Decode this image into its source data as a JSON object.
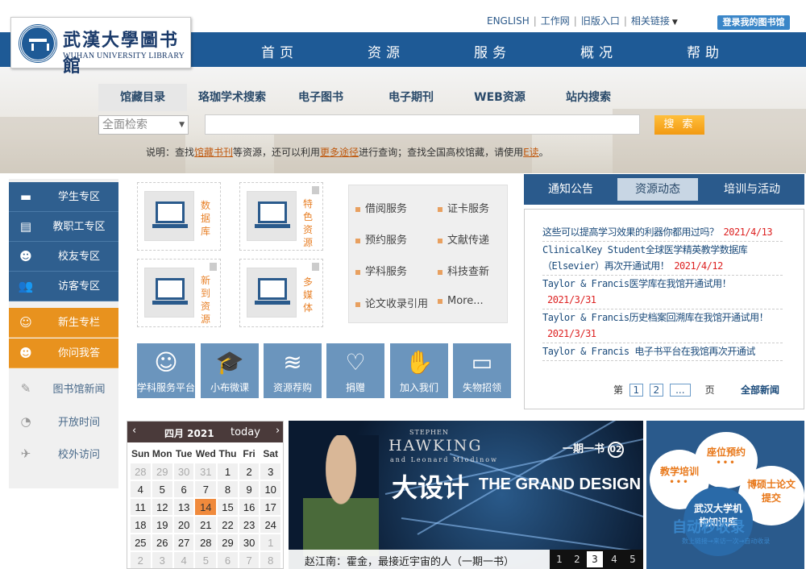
{
  "header": {
    "logo_cn": "武漢大學圖书館",
    "logo_en": "WUHAN UNIVERSITY LIBRARY",
    "top_links": [
      "ENGLISH",
      "工作网",
      "旧版入口",
      "相关链接"
    ],
    "my_library": "登录我的图书馆",
    "nav": [
      "首页",
      "资源",
      "服务",
      "概况",
      "帮助"
    ]
  },
  "search": {
    "tabs": [
      "馆藏目录",
      "珞珈学术搜索",
      "电子图书",
      "电子期刊",
      "WEB资源",
      "站内搜索"
    ],
    "select_value": "全面检索",
    "input_value": "",
    "button": "搜 索",
    "tip_prefix": "说明：查找",
    "tip_link1": "馆藏书刊",
    "tip_mid1": "等资源，还可以利用",
    "tip_link2": "更多途径",
    "tip_mid2": "进行查询；查找全国高校馆藏，请使用",
    "tip_link3": "E读",
    "tip_end": "。"
  },
  "sidebar": {
    "items": [
      {
        "label": "学生专区",
        "icon": "student-icon"
      },
      {
        "label": "教职工专区",
        "icon": "faculty-icon"
      },
      {
        "label": "校友专区",
        "icon": "alumni-icon"
      },
      {
        "label": "访客专区",
        "icon": "visitor-icon"
      },
      {
        "label": "新生专栏",
        "icon": "freshman-icon"
      },
      {
        "label": "你问我答",
        "icon": "qa-icon"
      },
      {
        "label": "图书馆新闻",
        "icon": "news-icon"
      },
      {
        "label": "开放时间",
        "icon": "clock-icon"
      },
      {
        "label": "校外访问",
        "icon": "offcampus-icon"
      }
    ]
  },
  "resources": [
    {
      "label": "数据库"
    },
    {
      "label": "特色资源"
    },
    {
      "label": "新到资源"
    },
    {
      "label": "多媒体"
    }
  ],
  "services": [
    "借阅服务",
    "证卡服务",
    "预约服务",
    "文献传递",
    "学科服务",
    "科技查新",
    "论文收录引用",
    "More..."
  ],
  "quick_links": [
    {
      "label": "学科服务平台",
      "icon": "people-icon"
    },
    {
      "label": "小布微课",
      "icon": "graduation-cap-icon"
    },
    {
      "label": "资源荐购",
      "icon": "books-icon"
    },
    {
      "label": "捐赠",
      "icon": "heart-icon"
    },
    {
      "label": "加入我们",
      "icon": "handshake-icon"
    },
    {
      "label": "失物招领",
      "icon": "signboard-icon"
    }
  ],
  "news": {
    "tabs": [
      "通知公告",
      "资源动态",
      "培训与活动"
    ],
    "items": [
      {
        "title": "这些可以提高学习效果的利器你都用过吗？",
        "date": "2021/4/13"
      },
      {
        "title": "ClinicalKey Student全球医学精英教学数据库（Elsevier）再次开通试用！",
        "date": "2021/4/12"
      },
      {
        "title": "Taylor & Francis医学库在我馆开通试用！",
        "date": "2021/3/31"
      },
      {
        "title": "Taylor & Francis历史档案回溯库在我馆开通试用！",
        "date": "2021/3/31"
      },
      {
        "title": "Taylor & Francis 电子书平台在我馆再次开通试",
        "date": ""
      }
    ],
    "pager_prefix": "第",
    "pages": [
      "1",
      "2",
      "..."
    ],
    "pager_suffix": "页",
    "more": "全部新闻"
  },
  "calendar": {
    "prev": "‹",
    "next": "›",
    "month": "四月 2021",
    "today_label": "today",
    "weekdays": [
      "Sun",
      "Mon",
      "Tue",
      "Wed",
      "Thu",
      "Fri",
      "Sat"
    ],
    "weeks": [
      [
        "28",
        "29",
        "30",
        "31",
        "1",
        "2",
        "3"
      ],
      [
        "4",
        "5",
        "6",
        "7",
        "8",
        "9",
        "10"
      ],
      [
        "11",
        "12",
        "13",
        "14",
        "15",
        "16",
        "17"
      ],
      [
        "18",
        "19",
        "20",
        "21",
        "22",
        "23",
        "24"
      ],
      [
        "25",
        "26",
        "27",
        "28",
        "29",
        "30",
        "1"
      ],
      [
        "2",
        "3",
        "4",
        "5",
        "6",
        "7",
        "8"
      ]
    ],
    "today": "14"
  },
  "banner": {
    "brand_top": "STEPHEN",
    "brand": "HAWKING",
    "brand_sub": "and Leonard Mlodinow",
    "series": "一期一书",
    "series_no": "02",
    "title_cn": "大设计",
    "title_en": "THE GRAND DESIGN",
    "caption": "赵江南：霍金，最接近宇宙的人（一期一书）",
    "slides": [
      "1",
      "2",
      "3",
      "4",
      "5"
    ],
    "active_slide": "3"
  },
  "service_bubbles": {
    "items": [
      "座位预约",
      "教学培训",
      "博硕士论文提交",
      "武汉大学机构知识库"
    ],
    "dots": "•••"
  },
  "watermark": {
    "text": "自动秒收录",
    "sub": "数上链接→来访一次→自动收录"
  }
}
